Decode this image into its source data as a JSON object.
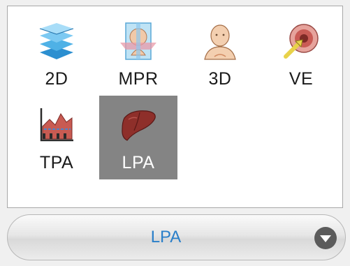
{
  "tools": [
    {
      "label": "2D",
      "icon": "layers-icon",
      "selected": false
    },
    {
      "label": "MPR",
      "icon": "mpr-head-icon",
      "selected": false
    },
    {
      "label": "3D",
      "icon": "3d-head-icon",
      "selected": false
    },
    {
      "label": "VE",
      "icon": "virtual-endoscopy-icon",
      "selected": false
    },
    {
      "label": "TPA",
      "icon": "tpa-chart-icon",
      "selected": false
    },
    {
      "label": "LPA",
      "icon": "liver-icon",
      "selected": true
    }
  ],
  "selector": {
    "value": "LPA",
    "icon": "chevron-down-icon"
  },
  "colors": {
    "selected_tile": "#848484",
    "selector_text": "#2a7fc9",
    "liver": "#8e2f2a"
  }
}
